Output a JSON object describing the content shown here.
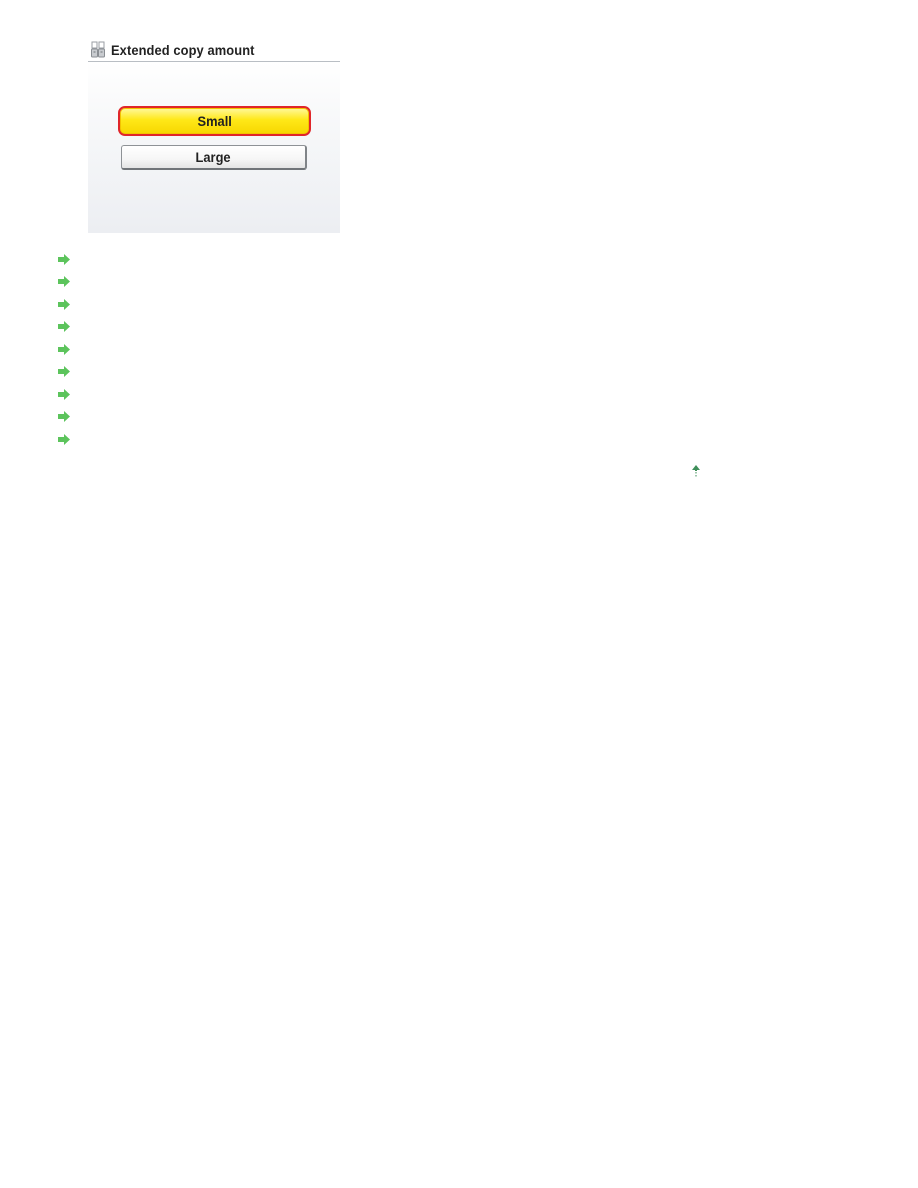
{
  "screen": {
    "title": "Extended copy amount",
    "title_icon": "extended-copy-icon",
    "options": [
      {
        "label": "Small",
        "selected": true
      },
      {
        "label": "Large",
        "selected": false
      }
    ]
  },
  "links": {
    "count": 9,
    "icon": "green-arrow-right-icon",
    "items": [
      "",
      "",
      "",
      "",
      "",
      "",
      "",
      "",
      ""
    ]
  },
  "page_top_link": {
    "icon": "arrow-up-icon"
  },
  "colors": {
    "selected_fill": "#ffe818",
    "selected_border": "#e0262a",
    "arrow_green": "#5cc45c",
    "up_arrow_green": "#3f8f5a"
  }
}
